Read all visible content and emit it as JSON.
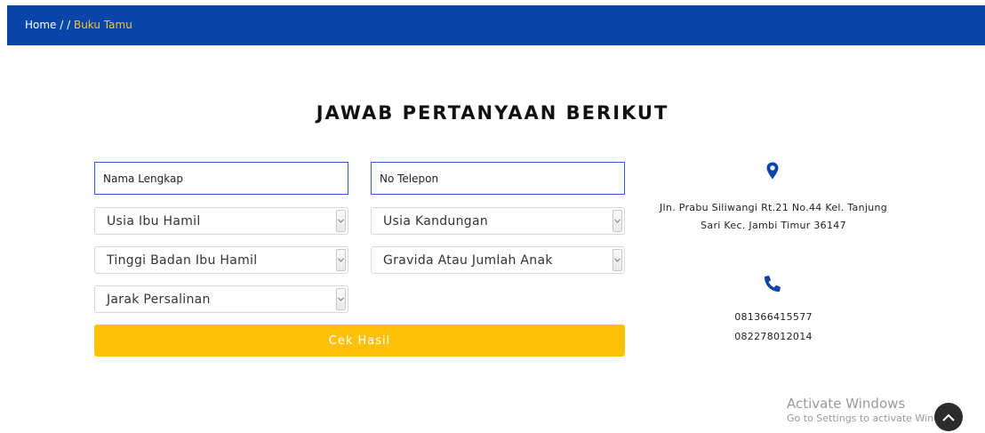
{
  "breadcrumb": {
    "home": "Home",
    "separator": " / / ",
    "current": "Buku Tamu"
  },
  "page": {
    "title": "JAWAB PERTANYAAN BERIKUT"
  },
  "form": {
    "nama_placeholder": "Nama Lengkap",
    "telepon_placeholder": "No Telepon",
    "usia_ibu_hamil": "Usia Ibu Hamil",
    "usia_kandungan": "Usia Kandungan",
    "tinggi_badan": "Tinggi Badan Ibu Hamil",
    "gravida": "Gravida Atau Jumlah Anak",
    "jarak_persalinan": "Jarak Persalinan",
    "submit_label": "Cek Hasil"
  },
  "contact": {
    "address_line1": "Jln. Prabu Siliwangi Rt.21 No.44 Kel. Tanjung",
    "address_line2": "Sari Kec. Jambi Timur 36147",
    "phone1": "081366415577",
    "phone2": "082278012014",
    "icons": [
      "map-pin-icon",
      "phone-icon"
    ]
  },
  "watermark": {
    "title": "Activate Windows",
    "subtitle": "Go to Settings to activate Windows."
  },
  "colors": {
    "header": "#0a46a8",
    "accent": "#f5c430",
    "button": "#ffc107",
    "icon": "#0a46a8"
  }
}
